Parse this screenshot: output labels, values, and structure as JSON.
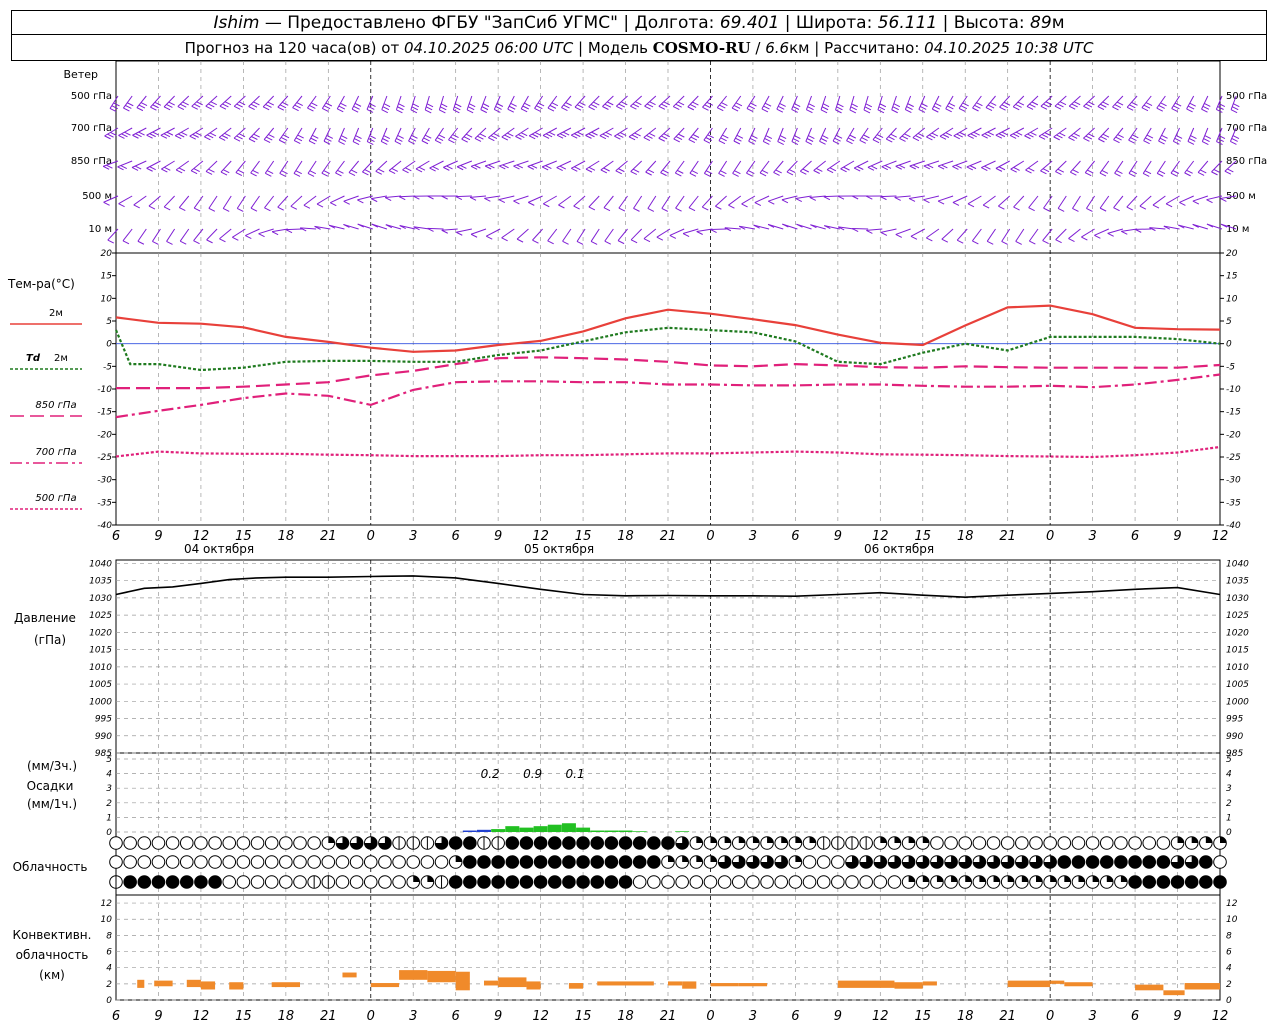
{
  "header": {
    "station": "Ishim",
    "provided": "— Предоставлено ФГБУ \"ЗапСиб УГМС\"",
    "lon_label": "Долгота:",
    "lon_value": "69.401",
    "lat_label": "Широта:",
    "lat_value": "56.111",
    "alt_label": "Высота:",
    "alt_value": "89",
    "alt_unit": "м",
    "forecast_prefix": "Прогноз на 120 часа(ов) от",
    "forecast_date": "04.10.2025 06:00 UTC",
    "model_label": "Модель",
    "model_name": "COSMO-RU",
    "model_res": "6.6",
    "model_unit": "км",
    "calc_label": "Рассчитано:",
    "calc_date": "04.10.2025 10:38 UTC"
  },
  "labels": {
    "wind": "Ветер",
    "wind_levels": [
      "500 гПа",
      "700 гПа",
      "850 гПа",
      "500 м",
      "10 м"
    ],
    "temp_title": "Тем-ра(°C)",
    "t2m": "2м",
    "td_a": "Td",
    "td_b": "2м",
    "t850": "850 гПа",
    "t700": "700 гПа",
    "t500": "500 гПа",
    "pressure_a": "Давление",
    "pressure_b": "(гПа)",
    "precip_a": "(мм/3ч.)",
    "precip_b": "Осадки",
    "precip_c": "(мм/1ч.)",
    "cloud": "Облачность",
    "conv_a": "Конвективн.",
    "conv_b": "облачность",
    "conv_c": "(км)",
    "dates": [
      "04 октября",
      "05 октября",
      "06 октября"
    ],
    "hour_ticks": [
      "6",
      "9",
      "12",
      "15",
      "18",
      "21",
      "0",
      "3",
      "6",
      "9",
      "12",
      "15",
      "18",
      "21",
      "0",
      "3",
      "6",
      "9",
      "12",
      "15",
      "18",
      "21",
      "0",
      "3",
      "6",
      "9",
      "12"
    ],
    "temp_ticks": [
      "20",
      "15",
      "10",
      "5",
      "0",
      "-5",
      "-10",
      "-15",
      "-20",
      "-25",
      "-30",
      "-35",
      "-40"
    ],
    "pressure_ticks": [
      "1040",
      "1035",
      "1030",
      "1025",
      "1020",
      "1015",
      "1010",
      "1005",
      "1000",
      "995",
      "990",
      "985"
    ],
    "precip_ticks": [
      "5",
      "4",
      "3",
      "2",
      "1",
      "0"
    ],
    "conv_ticks": [
      "12",
      "10",
      "8",
      "6",
      "4",
      "2",
      "0"
    ],
    "precip_totals": [
      "0.2",
      "0.9",
      "0.1"
    ]
  },
  "colors": {
    "wind": "#7f1fd4",
    "t2m": "#e8403a",
    "td": "#1f7a1f",
    "upper": "#e0207a",
    "pressure": "#000000",
    "precip_rain": "#22c022",
    "precip_conv": "#2040d0",
    "conv_cloud": "#f08a2a",
    "zero_line": "#3050e0"
  },
  "chart_data": [
    {
      "type": "line",
      "title": "Тем-ра(°C)",
      "x_unit": "hours from 04.10.2025 06:00 UTC",
      "x_range": [
        0,
        78
      ],
      "ylim": [
        -40,
        20
      ],
      "series": [
        {
          "name": "2м",
          "style": "solid",
          "x": [
            0,
            3,
            6,
            9,
            12,
            15,
            18,
            21,
            24,
            27,
            30,
            33,
            36,
            39,
            42,
            45,
            48,
            51,
            54,
            57,
            60,
            63,
            66,
            69,
            72,
            75,
            78
          ],
          "y": [
            5.8,
            4.6,
            4.4,
            3.6,
            1.5,
            0.4,
            -0.9,
            -1.8,
            -1.5,
            -0.3,
            0.6,
            2.7,
            5.6,
            7.5,
            6.6,
            5.4,
            4.1,
            2.0,
            0.2,
            -0.3,
            4.0,
            8.0,
            8.4,
            6.5,
            3.5,
            3.2,
            3.1
          ]
        },
        {
          "name": "Td 2м",
          "style": "dotted",
          "x": [
            0,
            1,
            3,
            6,
            9,
            12,
            15,
            18,
            21,
            24,
            27,
            30,
            33,
            36,
            39,
            42,
            45,
            48,
            51,
            54,
            57,
            60,
            63,
            66,
            69,
            72,
            75,
            78
          ],
          "y": [
            3.0,
            -4.5,
            -4.5,
            -5.8,
            -5.3,
            -4.0,
            -3.8,
            -3.8,
            -4.0,
            -4.0,
            -2.5,
            -1.5,
            0.5,
            2.5,
            3.5,
            3.0,
            2.5,
            0.5,
            -4.0,
            -4.5,
            -2.0,
            0.0,
            -1.5,
            1.5,
            1.5,
            1.5,
            1.0,
            0.0
          ]
        },
        {
          "name": "850 гПа",
          "style": "long-dash",
          "x": [
            0,
            3,
            6,
            9,
            12,
            15,
            18,
            21,
            24,
            27,
            30,
            33,
            36,
            39,
            42,
            45,
            48,
            51,
            54,
            57,
            60,
            63,
            66,
            69,
            72,
            75,
            78
          ],
          "y": [
            -9.8,
            -9.8,
            -9.8,
            -9.5,
            -9.0,
            -8.5,
            -7.0,
            -6.0,
            -4.5,
            -3.2,
            -3.0,
            -3.2,
            -3.5,
            -4.0,
            -4.8,
            -5.0,
            -4.5,
            -4.8,
            -5.2,
            -5.3,
            -5.0,
            -5.2,
            -5.3,
            -5.3,
            -5.3,
            -5.3,
            -4.7
          ]
        },
        {
          "name": "700 гПа",
          "style": "dash-dot",
          "x": [
            0,
            3,
            6,
            9,
            12,
            15,
            18,
            21,
            24,
            27,
            30,
            33,
            36,
            39,
            42,
            45,
            48,
            51,
            54,
            57,
            60,
            63,
            66,
            69,
            72,
            75,
            78
          ],
          "y": [
            -16.2,
            -14.8,
            -13.5,
            -12.0,
            -11.0,
            -11.5,
            -13.5,
            -10.2,
            -8.5,
            -8.3,
            -8.3,
            -8.5,
            -8.5,
            -9.0,
            -9.0,
            -9.2,
            -9.2,
            -9.0,
            -9.0,
            -9.3,
            -9.5,
            -9.5,
            -9.3,
            -9.6,
            -9.0,
            -8.0,
            -6.8
          ]
        },
        {
          "name": "500 гПа",
          "style": "dotted",
          "x": [
            0,
            3,
            6,
            9,
            12,
            15,
            18,
            21,
            24,
            27,
            30,
            33,
            36,
            39,
            42,
            45,
            48,
            51,
            54,
            57,
            60,
            63,
            66,
            69,
            72,
            75,
            78
          ],
          "y": [
            -24.9,
            -23.8,
            -24.2,
            -24.3,
            -24.3,
            -24.5,
            -24.6,
            -24.8,
            -24.8,
            -24.8,
            -24.6,
            -24.6,
            -24.4,
            -24.2,
            -24.2,
            -24.0,
            -23.8,
            -24.0,
            -24.4,
            -24.5,
            -24.6,
            -24.8,
            -24.9,
            -25.0,
            -24.6,
            -24.0,
            -22.8
          ]
        }
      ]
    },
    {
      "type": "line",
      "title": "Давление (гПа)",
      "x_unit": "hours from 04.10.2025 06:00 UTC",
      "x_range": [
        0,
        78
      ],
      "ylim": [
        985,
        1040
      ],
      "series": [
        {
          "name": "Давление",
          "x": [
            0,
            2,
            4,
            6,
            8,
            10,
            12,
            15,
            18,
            21,
            24,
            27,
            30,
            33,
            36,
            39,
            42,
            45,
            48,
            51,
            54,
            57,
            60,
            63,
            66,
            69,
            72,
            75,
            78
          ],
          "y": [
            1031.0,
            1032.8,
            1033.2,
            1034.2,
            1035.3,
            1035.8,
            1036.0,
            1036.0,
            1036.2,
            1036.4,
            1035.8,
            1034.2,
            1032.5,
            1031.0,
            1030.6,
            1030.7,
            1030.6,
            1030.6,
            1030.5,
            1031.0,
            1031.5,
            1030.8,
            1030.2,
            1030.8,
            1031.3,
            1031.8,
            1032.5,
            1033.0,
            1031.0
          ]
        }
      ]
    },
    {
      "type": "bar",
      "title": "Осадки",
      "x_unit": "hours from 04.10.2025 06:00 UTC",
      "ylim": [
        0,
        5
      ],
      "series": [
        {
          "name": "1h",
          "x": [
            25,
            26,
            27,
            28,
            29,
            30,
            31,
            32,
            33,
            34,
            35,
            36,
            37,
            40
          ],
          "y": [
            0.1,
            0.15,
            0.2,
            0.4,
            0.3,
            0.4,
            0.5,
            0.6,
            0.3,
            0.1,
            0.1,
            0.1,
            0.05,
            0.05
          ]
        }
      ],
      "totals_3h": [
        {
          "x": 27,
          "value": "0.2"
        },
        {
          "x": 30,
          "value": "0.9"
        },
        {
          "x": 33,
          "value": "0.1"
        }
      ]
    },
    {
      "type": "table",
      "title": "Облачность",
      "note": "cover per step in eighths, rows: upper, middle, lower",
      "x": [
        0,
        1,
        2,
        3,
        4,
        5,
        6,
        7,
        8,
        9,
        10,
        11,
        12,
        13,
        14,
        15,
        16,
        17,
        18,
        19,
        20,
        21,
        22,
        23,
        24,
        25,
        26,
        27,
        28,
        29,
        30,
        31,
        32,
        33,
        34,
        35,
        36,
        37,
        38,
        39,
        40,
        41,
        42,
        43,
        44,
        45,
        46,
        47,
        48,
        49,
        50,
        51,
        52,
        53,
        54,
        55,
        56,
        57,
        58,
        59,
        60,
        61,
        62,
        63,
        64,
        65,
        66,
        67,
        68,
        69,
        70,
        71,
        72,
        73,
        74,
        75,
        76,
        77,
        78
      ],
      "rows": [
        [
          0,
          0,
          0,
          0,
          0,
          0,
          0,
          0,
          0,
          0,
          0,
          0,
          0,
          0,
          0,
          3,
          5,
          7,
          7,
          7,
          4,
          4,
          4,
          5,
          8,
          8,
          4,
          4,
          8,
          8,
          8,
          8,
          8,
          8,
          8,
          8,
          8,
          8,
          8,
          8,
          5,
          3,
          3,
          3,
          3,
          3,
          3,
          3,
          3,
          3,
          4,
          4,
          4,
          4,
          3,
          3,
          3,
          3,
          0,
          0,
          0,
          0,
          0,
          0,
          0,
          0,
          0,
          0,
          0,
          0,
          0,
          0,
          0,
          0,
          0,
          3,
          3,
          3,
          3
        ],
        [
          0,
          0,
          0,
          0,
          0,
          0,
          0,
          0,
          0,
          0,
          0,
          0,
          0,
          0,
          0,
          0,
          0,
          0,
          0,
          0,
          0,
          0,
          0,
          0,
          3,
          8,
          8,
          8,
          8,
          8,
          8,
          8,
          8,
          8,
          8,
          8,
          8,
          8,
          8,
          3,
          3,
          3,
          3,
          5,
          5,
          5,
          5,
          5,
          3,
          0,
          0,
          0,
          5,
          5,
          5,
          5,
          5,
          5,
          5,
          5,
          5,
          5,
          5,
          5,
          5,
          5,
          5,
          8,
          8,
          8,
          8,
          8,
          8,
          8,
          8,
          5,
          5,
          8,
          0
        ],
        [
          4,
          8,
          8,
          8,
          8,
          8,
          8,
          8,
          0,
          0,
          0,
          0,
          0,
          0,
          4,
          4,
          0,
          0,
          0,
          0,
          0,
          3,
          3,
          4,
          8,
          8,
          8,
          8,
          8,
          8,
          8,
          8,
          8,
          8,
          8,
          8,
          8,
          0,
          0,
          0,
          0,
          0,
          0,
          0,
          0,
          0,
          0,
          0,
          0,
          0,
          0,
          0,
          0,
          0,
          0,
          0,
          3,
          3,
          3,
          3,
          3,
          3,
          3,
          3,
          3,
          3,
          3,
          3,
          3,
          3,
          3,
          3,
          8,
          8,
          8,
          8,
          8,
          8,
          8
        ]
      ]
    },
    {
      "type": "bar",
      "title": "Конвективн. облачность (км)",
      "x_unit": "hours from 04.10.2025 06:00 UTC",
      "ylim": [
        0,
        13
      ],
      "series": [
        {
          "name": "base-top",
          "segments": [
            [
              1.5,
              2.0,
              1.5,
              2.5
            ],
            [
              2.7,
              4.0,
              1.7,
              2.4
            ],
            [
              5.0,
              6.0,
              1.6,
              2.5
            ],
            [
              6.0,
              7.0,
              1.3,
              2.3
            ],
            [
              8.0,
              9.0,
              1.3,
              2.2
            ],
            [
              11.0,
              13.0,
              1.6,
              2.2
            ],
            [
              16.0,
              17.0,
              2.8,
              3.4
            ],
            [
              18.0,
              20.0,
              1.6,
              2.1
            ],
            [
              20.0,
              22.0,
              2.5,
              3.7
            ],
            [
              22.0,
              24.0,
              2.2,
              3.6
            ],
            [
              24.0,
              25.0,
              1.2,
              3.5
            ],
            [
              26.0,
              27.0,
              1.8,
              2.4
            ],
            [
              27.0,
              29.0,
              1.6,
              2.8
            ],
            [
              29.0,
              30.0,
              1.3,
              2.3
            ],
            [
              32.0,
              33.0,
              1.4,
              2.1
            ],
            [
              34.0,
              38.0,
              1.8,
              2.3
            ],
            [
              39.0,
              40.0,
              1.8,
              2.3
            ],
            [
              40.0,
              41.0,
              1.4,
              2.3
            ],
            [
              42.0,
              44.0,
              1.7,
              2.1
            ],
            [
              44.0,
              46.0,
              1.7,
              2.1
            ],
            [
              51.0,
              55.0,
              1.5,
              2.4
            ],
            [
              55.0,
              57.0,
              1.4,
              2.2
            ],
            [
              57.0,
              58.0,
              1.8,
              2.3
            ],
            [
              63.0,
              66.0,
              1.6,
              2.4
            ],
            [
              66.0,
              67.0,
              2.0,
              2.4
            ],
            [
              67.0,
              69.0,
              1.7,
              2.2
            ],
            [
              72.0,
              74.0,
              1.2,
              1.9
            ],
            [
              74.0,
              75.5,
              0.6,
              1.2
            ],
            [
              75.5,
              78.0,
              1.3,
              2.1
            ]
          ]
        }
      ]
    }
  ]
}
